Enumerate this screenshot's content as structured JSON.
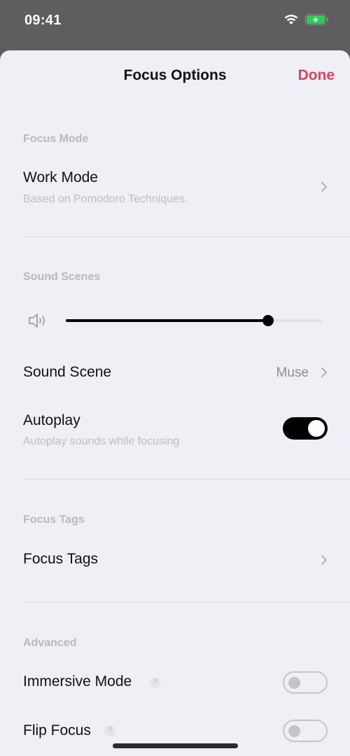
{
  "status_bar": {
    "time": "09:41",
    "icons": [
      "wifi-icon",
      "battery-charging-icon"
    ],
    "battery_color": "#34c759"
  },
  "nav": {
    "title": "Focus Options",
    "done_label": "Done",
    "accent_color": "#e0415e"
  },
  "sections": {
    "focus_mode": {
      "header": "Focus Mode",
      "work_mode": {
        "title": "Work Mode",
        "subtitle": "Based on Pomodoro Techniques."
      }
    },
    "sound_scenes": {
      "header": "Sound Scenes",
      "volume": {
        "icon": "speaker-volume-icon",
        "value": 0.79
      },
      "sound_scene": {
        "title": "Sound Scene",
        "value": "Muse"
      },
      "autoplay": {
        "title": "Autoplay",
        "subtitle": "Autoplay sounds while focusing",
        "enabled": true
      }
    },
    "focus_tags": {
      "header": "Focus Tags",
      "focus_tags_row": {
        "title": "Focus Tags"
      }
    },
    "advanced": {
      "header": "Advanced",
      "immersive_mode": {
        "title": "Immersive Mode",
        "help": "?",
        "enabled": false
      },
      "flip_focus": {
        "title": "Flip Focus",
        "help": "?",
        "enabled": false
      }
    }
  }
}
